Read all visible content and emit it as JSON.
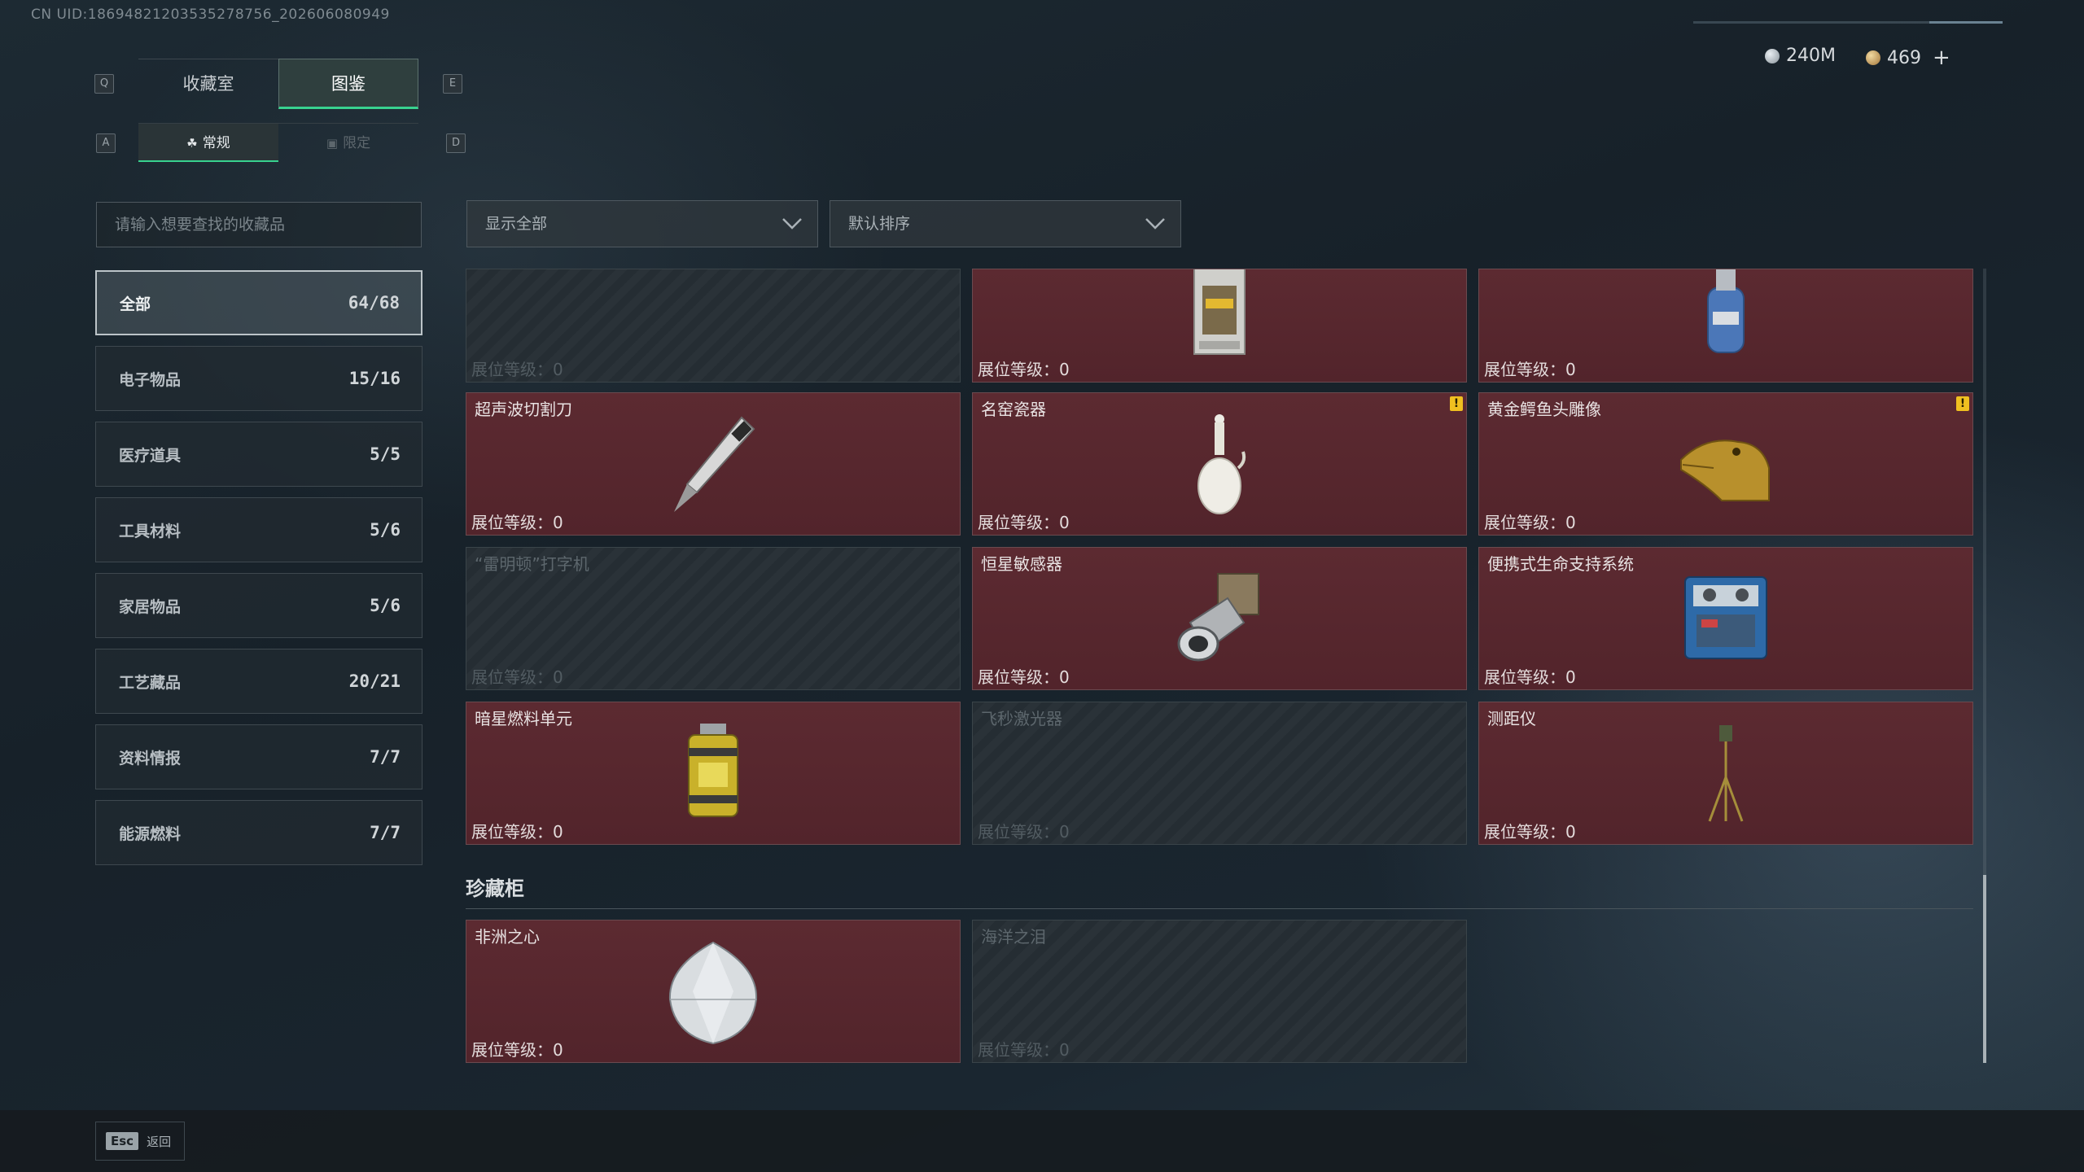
{
  "uid": "CN UID:18694821203535278756_202606080949",
  "currency": {
    "silver": "240M",
    "gold": "469",
    "plus": "+"
  },
  "keys": {
    "q": "Q",
    "e": "E",
    "a": "A",
    "d": "D"
  },
  "main_tabs": [
    {
      "label": "收藏室"
    },
    {
      "label": "图鉴"
    }
  ],
  "sub_tabs": [
    {
      "label": "常规"
    },
    {
      "label": "限定"
    }
  ],
  "search": {
    "placeholder": "请输入想要查找的收藏品"
  },
  "categories": [
    {
      "label": "全部",
      "count": "64/68"
    },
    {
      "label": "电子物品",
      "count": "15/16"
    },
    {
      "label": "医疗道具",
      "count": "5/5"
    },
    {
      "label": "工具材料",
      "count": "5/6"
    },
    {
      "label": "家居物品",
      "count": "5/6"
    },
    {
      "label": "工艺藏品",
      "count": "20/21"
    },
    {
      "label": "资料情报",
      "count": "7/7"
    },
    {
      "label": "能源燃料",
      "count": "7/7"
    }
  ],
  "filters": {
    "filter": "显示全部",
    "sort": "默认排序"
  },
  "level_label": "展位等级：0",
  "items": [
    {
      "name": "",
      "level": "展位等级：0"
    },
    {
      "name": "",
      "level": "展位等级：0"
    },
    {
      "name": "",
      "level": "展位等级：0"
    },
    {
      "name": "超声波切割刀",
      "level": "展位等级：0"
    },
    {
      "name": "名窑瓷器",
      "level": "展位等级：0"
    },
    {
      "name": "黄金鳄鱼头雕像",
      "level": "展位等级：0"
    },
    {
      "name": "“雷明顿”打字机",
      "level": "展位等级：0"
    },
    {
      "name": "恒星敏感器",
      "level": "展位等级：0"
    },
    {
      "name": "便携式生命支持系统",
      "level": "展位等级：0"
    },
    {
      "name": "暗星燃料单元",
      "level": "展位等级：0"
    },
    {
      "name": "飞秒激光器",
      "level": "展位等级：0"
    },
    {
      "name": "测距仪",
      "level": "展位等级：0"
    }
  ],
  "section": {
    "title": "珍藏柜"
  },
  "treasures": [
    {
      "name": "非洲之心",
      "level": "展位等级：0"
    },
    {
      "name": "海洋之泪",
      "level": "展位等级：0"
    }
  ],
  "warn_mark": "!",
  "bottom": {
    "esc_key": "Esc",
    "back": "返回"
  }
}
